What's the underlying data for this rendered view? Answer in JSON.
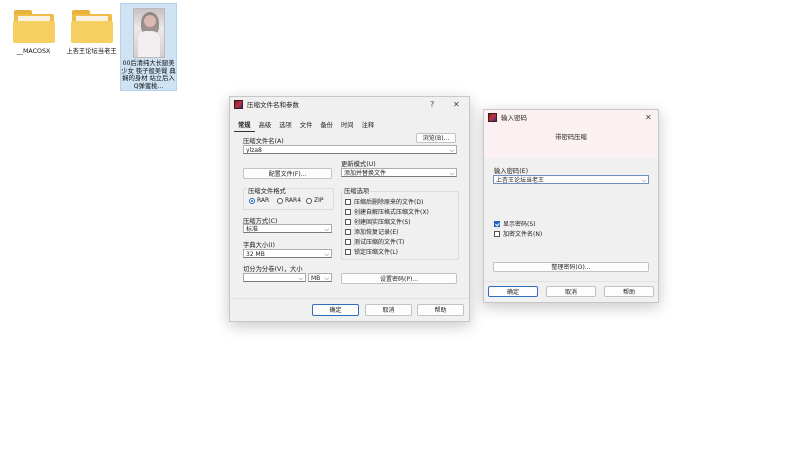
{
  "desktop": {
    "items": [
      {
        "label": "__MACOSX",
        "kind": "folder"
      },
      {
        "label": "上杏王论坛当老王",
        "kind": "folder"
      },
      {
        "label": "00后清纯大长腿美少女 筷子般美臀 典娴的身材 站立后入Q弹蜜桃...",
        "kind": "image"
      }
    ]
  },
  "archive_dialog": {
    "title": "压缩文件名和参数",
    "help_symbol": "?",
    "close_symbol": "✕",
    "tabs": [
      "常规",
      "高级",
      "选项",
      "文件",
      "备份",
      "时间",
      "注释"
    ],
    "active_tab": "常规",
    "archive_name_label": "压缩文件名(A)",
    "browse_button": "浏览(B)...",
    "archive_name_value": "ylza8",
    "update_mode_label": "更新模式(U)",
    "update_mode_value": "添加并替换文件",
    "profiles_button": "配置文件(F)...",
    "format_group_label": "压缩文件格式",
    "formats": [
      "RAR",
      "RAR4",
      "ZIP"
    ],
    "selected_format": "RAR",
    "options_group_label": "压缩选项",
    "options": [
      {
        "label": "压缩后删除原来的文件(D)",
        "checked": false
      },
      {
        "label": "创建自解压格式压缩文件(X)",
        "checked": false
      },
      {
        "label": "创建固实压缩文件(S)",
        "checked": false
      },
      {
        "label": "添加恢复记录(E)",
        "checked": false
      },
      {
        "label": "测试压缩的文件(T)",
        "checked": false
      },
      {
        "label": "锁定压缩文件(L)",
        "checked": false
      }
    ],
    "method_label": "压缩方式(C)",
    "method_value": "标准",
    "dict_label": "字典大小(I)",
    "dict_value": "32 MB",
    "split_label": "切分为分卷(V)，大小",
    "split_unit": "MB",
    "set_password_button": "设置密码(P)...",
    "ok_button": "确定",
    "cancel_button": "取消",
    "help_button": "帮助"
  },
  "password_dialog": {
    "title": "输入密码",
    "close_symbol": "✕",
    "subtitle": "带密码压缩",
    "password_label": "输入密码(E)",
    "password_value": "上杏王论坛当老王",
    "show_password": {
      "label": "显示密码(S)",
      "checked": true
    },
    "encrypt_names": {
      "label": "加密文件名(N)",
      "checked": false
    },
    "organize_button": "整理密码(O)...",
    "ok_button": "确定",
    "cancel_button": "取消",
    "help_button": "帮助"
  },
  "colors": {
    "accent": "#1f66c1",
    "folder": "#f6cf62",
    "dialog_bg": "#f0f0f0"
  }
}
